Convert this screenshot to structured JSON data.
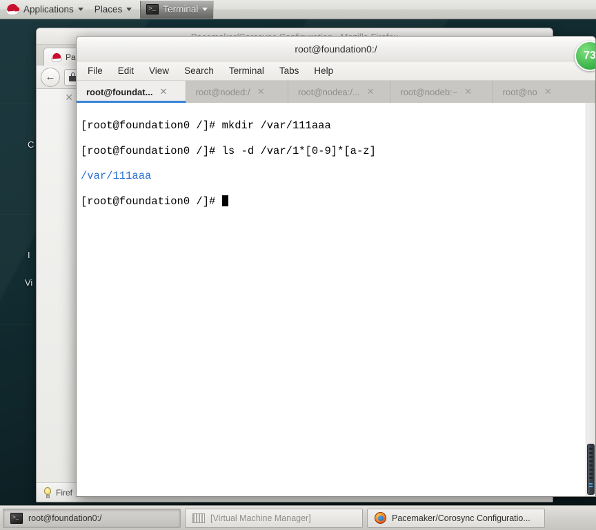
{
  "top_panel": {
    "applications_label": "Applications",
    "places_label": "Places",
    "window_label": "Terminal",
    "logo_icon": "redhat-logo-icon",
    "caret_icon": "chevron-down-icon"
  },
  "firefox_window": {
    "title": "Pacemaker/Corosync Configuration - Mozilla Firefox",
    "tab_label": "Pa",
    "url_value": "",
    "back_icon": "back-arrow-icon",
    "lock_icon": "lock-icon",
    "close_icon": "close-icon",
    "status_text": "Firef",
    "bulb_icon": "lightbulb-icon",
    "checkboxes": [
      false,
      true,
      true,
      false,
      false
    ]
  },
  "desktop": {
    "icon_labels": [
      "C",
      "I",
      "Vi"
    ]
  },
  "terminal_window": {
    "title": "root@foundation0:/",
    "menu": [
      "File",
      "Edit",
      "View",
      "Search",
      "Terminal",
      "Tabs",
      "Help"
    ],
    "tabs": [
      {
        "label": "root@foundat...",
        "active": true,
        "close_icon": "close-icon"
      },
      {
        "label": "root@noded:/",
        "active": false,
        "close_icon": "close-icon"
      },
      {
        "label": "root@nodea:/...",
        "active": false,
        "close_icon": "close-icon"
      },
      {
        "label": "root@nodeb:~",
        "active": false,
        "close_icon": "close-icon"
      },
      {
        "label": "root@no",
        "active": false,
        "close_icon": "close-icon"
      }
    ],
    "lines": [
      {
        "segments": [
          {
            "text": "[root@foundation0 /]# mkdir /var/111aaa",
            "color": "default"
          }
        ]
      },
      {
        "segments": [
          {
            "text": "[root@foundation0 /]# ls -d /var/1*[0-9]*[a-z]",
            "color": "default"
          }
        ]
      },
      {
        "segments": [
          {
            "text": "/var/111aaa",
            "color": "blue"
          }
        ]
      },
      {
        "segments": [
          {
            "text": "[root@foundation0 /]# ",
            "color": "default"
          }
        ],
        "cursor": true
      }
    ],
    "badge_value": "73",
    "scrollbar_name": "terminal-scrollbar"
  },
  "taskbar": {
    "items": [
      {
        "label": "root@foundation0:/",
        "icon": "terminal-icon",
        "state": "active"
      },
      {
        "label": "[Virtual Machine Manager]",
        "icon": "vmm-icon",
        "state": "minimized"
      },
      {
        "label": "Pacemaker/Corosync Configuratio...",
        "icon": "firefox-icon",
        "state": "normal"
      }
    ]
  },
  "colors": {
    "accent_blue": "#3584d6",
    "terminal_output_blue": "#2a6fd6",
    "badge_green": "#3cb44a",
    "desktop_teal": "#122c31"
  }
}
